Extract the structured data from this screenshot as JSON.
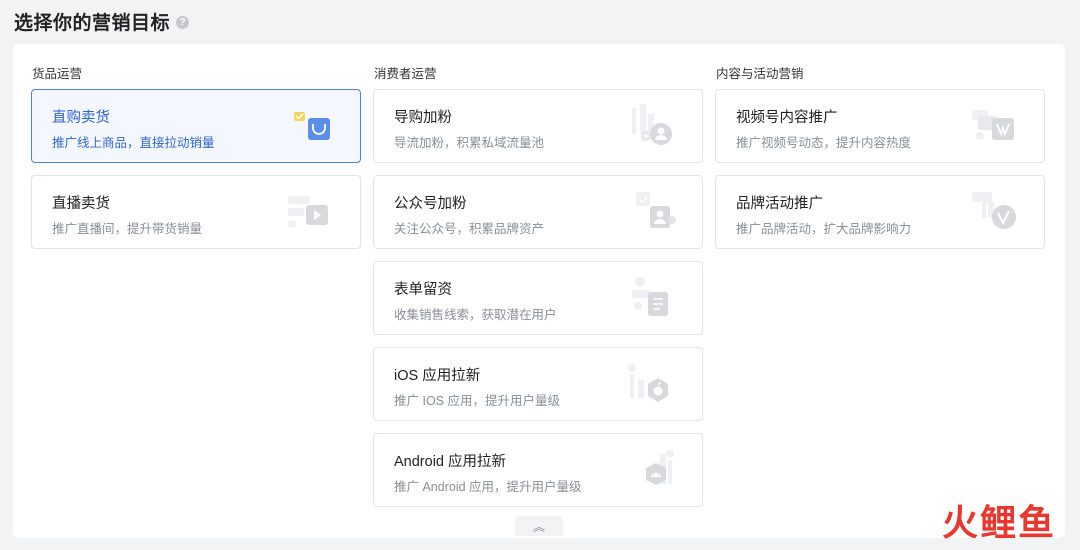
{
  "header": {
    "title": "选择你的营销目标",
    "help_icon": "question-circle-icon"
  },
  "columns": [
    {
      "title": "货品运营",
      "cards": [
        {
          "title": "直购卖货",
          "desc": "推广线上商品，直接拉动销量",
          "icon": "shopping-bag-icon",
          "selected": true
        },
        {
          "title": "直播卖货",
          "desc": "推广直播间，提升带货销量",
          "icon": "live-play-icon",
          "selected": false
        }
      ]
    },
    {
      "title": "消费者运营",
      "cards": [
        {
          "title": "导购加粉",
          "desc": "导流加粉，积累私域流量池",
          "icon": "add-user-icon"
        },
        {
          "title": "公众号加粉",
          "desc": "关注公众号，积累品牌资产",
          "icon": "official-account-icon"
        },
        {
          "title": "表单留资",
          "desc": "收集销售线索，获取潜在用户",
          "icon": "form-icon"
        },
        {
          "title": "iOS 应用拉新",
          "desc": "推广 IOS 应用，提升用户量级",
          "icon": "apple-icon"
        },
        {
          "title": "Android 应用拉新",
          "desc": "推广 Android 应用，提升用户量级",
          "icon": "android-icon"
        }
      ]
    },
    {
      "title": "内容与活动营销",
      "cards": [
        {
          "title": "视频号内容推广",
          "desc": "推广视频号动态，提升内容热度",
          "icon": "channels-icon"
        },
        {
          "title": "品牌活动推广",
          "desc": "推广品牌活动，扩大品牌影响力",
          "icon": "brand-v-icon"
        }
      ]
    }
  ],
  "collapse": {
    "icon": "double-chevron-up-icon",
    "glyph": "︽"
  },
  "watermark": {
    "c1": "火",
    "c2": "鲤",
    "c3": "鱼"
  },
  "colors": {
    "accent": "#2f66d1",
    "selected_border": "#4c80e0",
    "watermark": "#e8372f"
  }
}
